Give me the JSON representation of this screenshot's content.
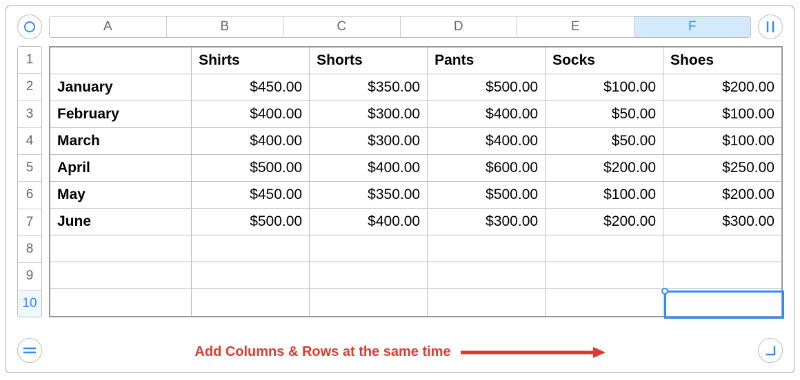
{
  "columns": [
    "A",
    "B",
    "C",
    "D",
    "E",
    "F"
  ],
  "selected_column_index": 5,
  "rows": [
    "1",
    "2",
    "3",
    "4",
    "5",
    "6",
    "7",
    "8",
    "9",
    "10"
  ],
  "selected_row_index": 9,
  "headers": [
    "Shirts",
    "Shorts",
    "Pants",
    "Socks",
    "Shoes"
  ],
  "data_rows": [
    {
      "label": "January",
      "values": [
        "$450.00",
        "$350.00",
        "$500.00",
        "$100.00",
        "$200.00"
      ]
    },
    {
      "label": "February",
      "values": [
        "$400.00",
        "$300.00",
        "$400.00",
        "$50.00",
        "$100.00"
      ]
    },
    {
      "label": "March",
      "values": [
        "$400.00",
        "$300.00",
        "$400.00",
        "$50.00",
        "$100.00"
      ]
    },
    {
      "label": "April",
      "values": [
        "$500.00",
        "$400.00",
        "$600.00",
        "$200.00",
        "$250.00"
      ]
    },
    {
      "label": "May",
      "values": [
        "$450.00",
        "$350.00",
        "$500.00",
        "$100.00",
        "$200.00"
      ]
    },
    {
      "label": "June",
      "values": [
        "$500.00",
        "$400.00",
        "$300.00",
        "$200.00",
        "$300.00"
      ]
    }
  ],
  "empty_rows": 3,
  "cursor_cell": {
    "col": 5,
    "row": 9
  },
  "annotation": "Add Columns & Rows at the same time",
  "colors": {
    "accent": "#2e8dfb",
    "annot": "#e1392e"
  }
}
